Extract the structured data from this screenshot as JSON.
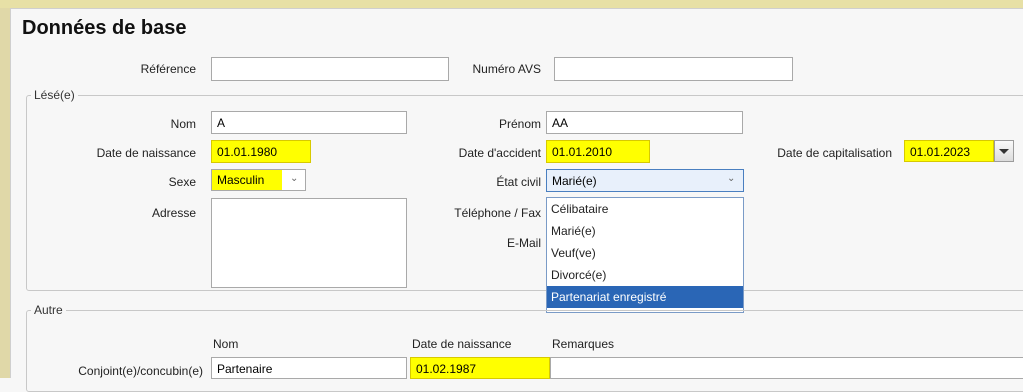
{
  "form": {
    "title": "Données de base",
    "reference": {
      "label": "Référence",
      "value": ""
    },
    "avs": {
      "label": "Numéro AVS",
      "value": ""
    }
  },
  "lese": {
    "group_title": "Lésé(e)",
    "nom": {
      "label": "Nom",
      "value": "A"
    },
    "prenom": {
      "label": "Prénom",
      "value": "AA"
    },
    "date_naissance": {
      "label": "Date de naissance",
      "value": "01.01.1980"
    },
    "date_accident": {
      "label": "Date d'accident",
      "value": "01.01.2010"
    },
    "date_capitalisation": {
      "label": "Date de capitalisation",
      "value": "01.01.2023"
    },
    "sexe": {
      "label": "Sexe",
      "value": "Masculin"
    },
    "etat_civil": {
      "label": "État civil",
      "value": "Marié(e)",
      "options": [
        "Célibataire",
        "Marié(e)",
        "Veuf(ve)",
        "Divorcé(e)",
        "Partenariat enregistré"
      ],
      "highlighted": "Partenariat enregistré"
    },
    "adresse": {
      "label": "Adresse",
      "value": ""
    },
    "telephone": {
      "label": "Téléphone / Fax"
    },
    "email": {
      "label": "E-Mail"
    }
  },
  "autre": {
    "group_title": "Autre",
    "col_nom": "Nom",
    "col_date": "Date de naissance",
    "col_remarques": "Remarques",
    "conjoint": {
      "label": "Conjoint(e)/concubin(e)",
      "nom": "Partenaire",
      "date": "01.02.1987",
      "remarques": ""
    }
  },
  "colors": {
    "highlight_field": "#ffff00",
    "selection": "#2a66b6"
  },
  "icons": {
    "combo_chevron": "chevron-down-icon",
    "dropdown_button": "triangle-down-icon"
  }
}
